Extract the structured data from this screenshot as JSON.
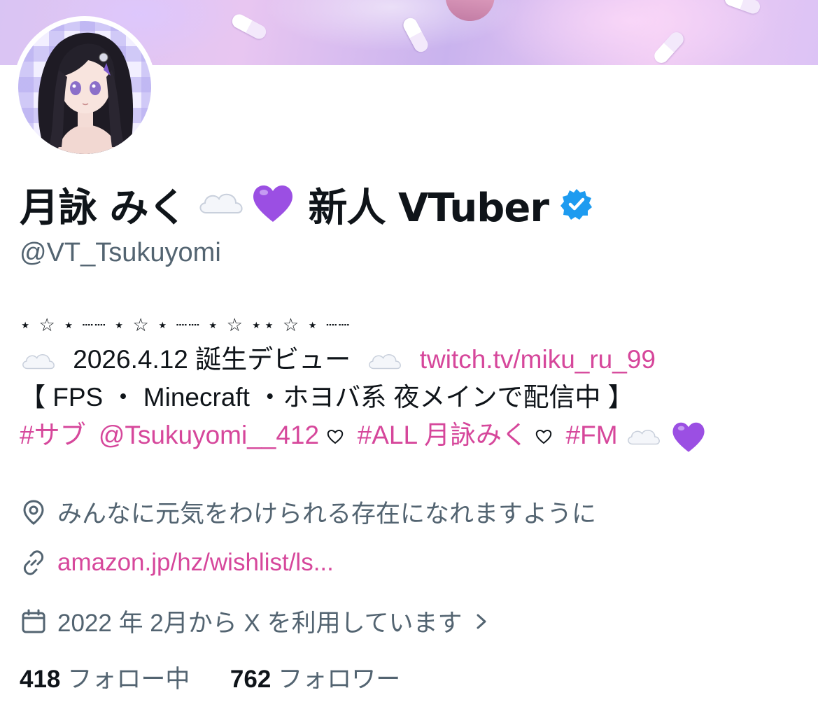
{
  "profile": {
    "display_name": "月詠 みく",
    "display_name_suffix": "新人 VTuber",
    "handle": "@VT_Tsukuyomi",
    "verified": true
  },
  "bio": {
    "decor_line": "⋆ ☆ ⋆ ┈┈ ⋆ ☆ ⋆ ┈┈ ⋆ ☆ ⋆⋆ ☆ ⋆ ┈┈",
    "debut_text": "2026.4.12 誕生デビュー",
    "twitch_link": "twitch.tv/miku_ru_99",
    "stream_info": "【 FPS ・ Minecraft ・ホヨバ系 夜メインで配信中 】",
    "tag_sub": "#サブ",
    "mention_sub": "@Tsukuyomi__412",
    "tag_all": "#ALL 月詠みく",
    "tag_fm": "#FM"
  },
  "meta": {
    "location": "みんなに元気をわけられる存在になれますように",
    "website": "amazon.jp/hz/wishlist/ls...",
    "joined": "2022 年 2月から X を利用しています"
  },
  "stats": {
    "following_count": "418",
    "following_label": "フォロー中",
    "followers_count": "762",
    "followers_label": "フォロワー"
  },
  "icons": {
    "cloud": "cloud-emoji",
    "purple_heart": "purple-heart-emoji",
    "white_heart": "white-heart-emoji",
    "verified": "verified-badge-icon",
    "location": "location-pin-icon",
    "link": "link-icon",
    "calendar": "calendar-icon",
    "chevron": "chevron-right-icon"
  },
  "colors": {
    "accent": "#d6479b",
    "verified": "#1d9bf0",
    "secondary_text": "#536471"
  }
}
